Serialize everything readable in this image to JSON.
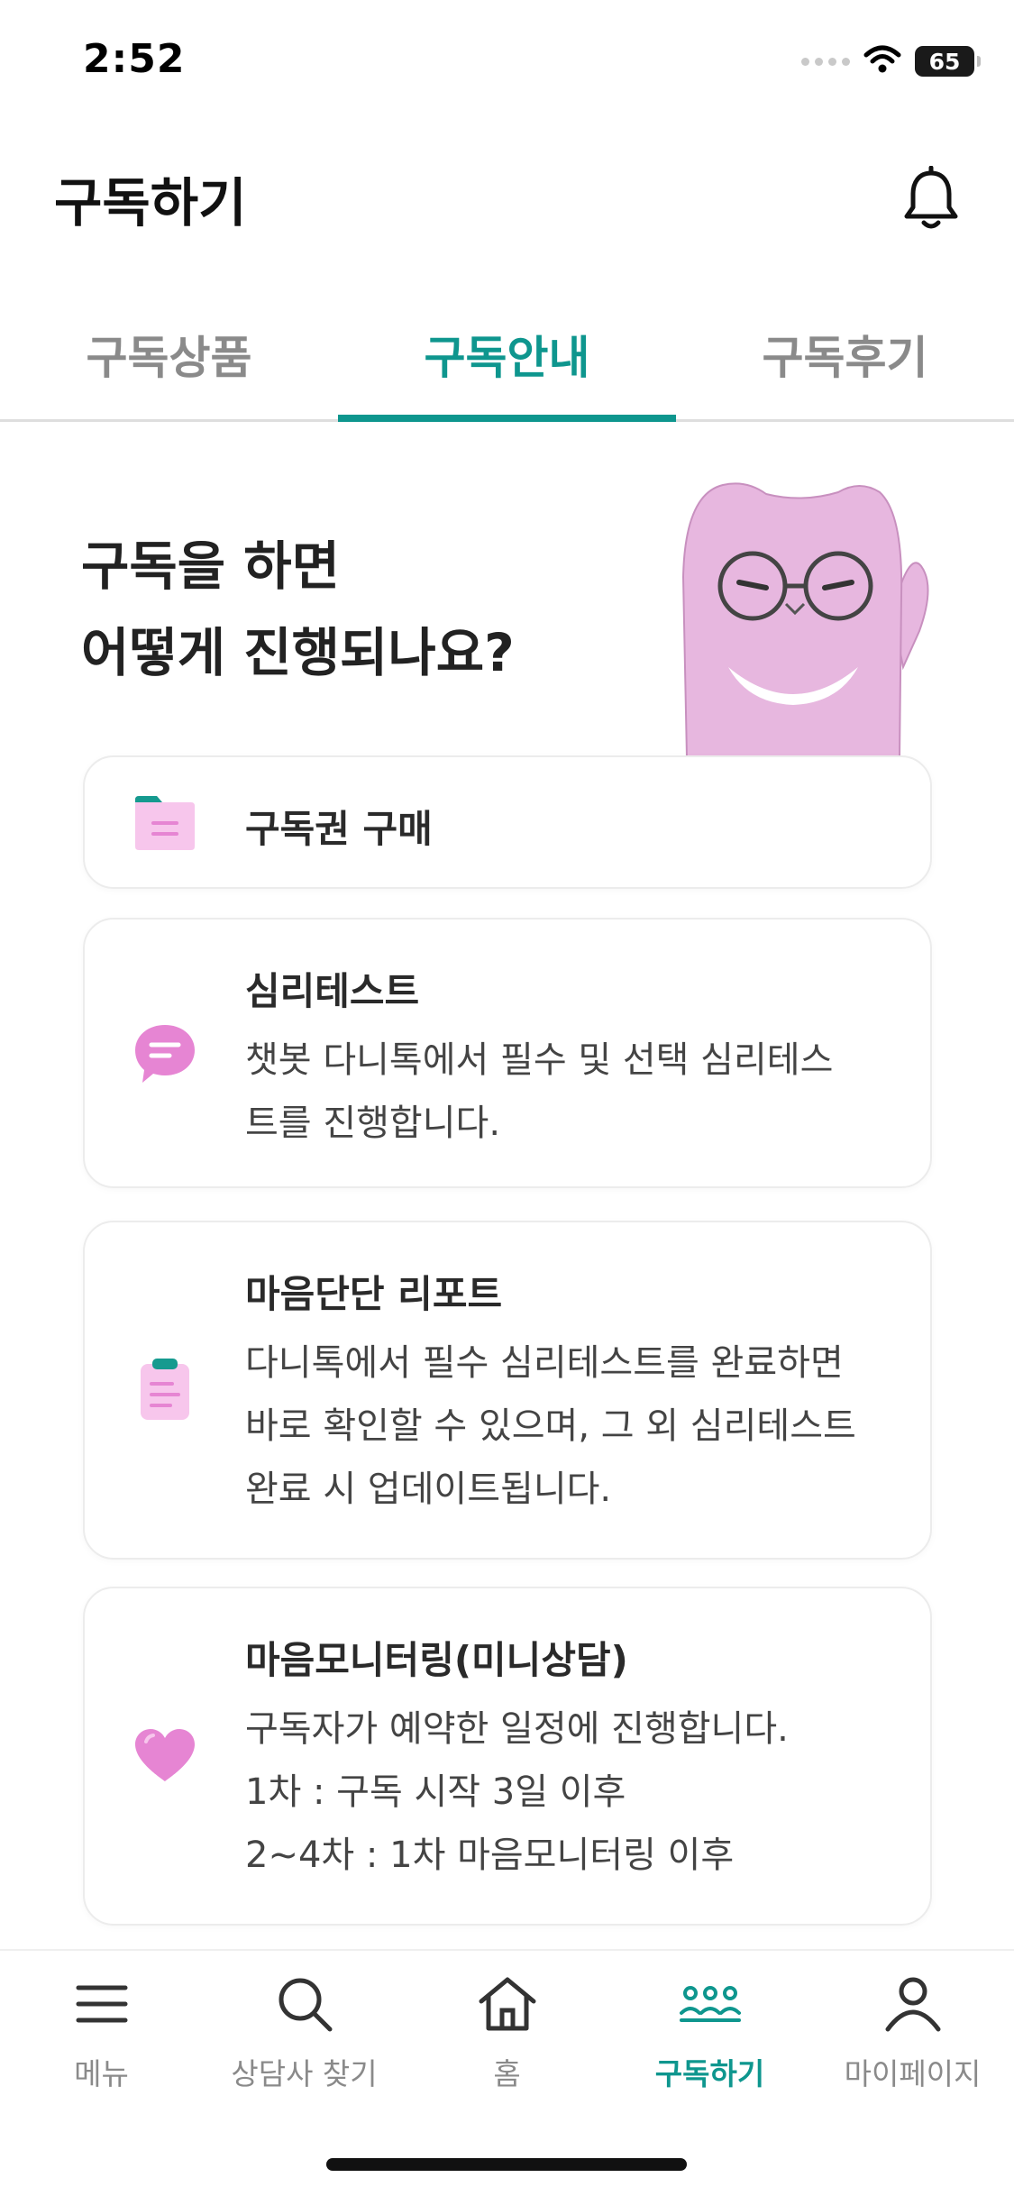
{
  "status_bar": {
    "time": "2:52",
    "battery": "65"
  },
  "header": {
    "title": "구독하기",
    "bell_icon": "bell-icon"
  },
  "tabs": [
    {
      "label": "구독상품",
      "active": false
    },
    {
      "label": "구독안내",
      "active": true
    },
    {
      "label": "구독후기",
      "active": false
    }
  ],
  "intro": {
    "line1": "구독을 하면",
    "line2": "어떻게 진행되나요?"
  },
  "steps": [
    {
      "title": "구독권 구매",
      "icon": "folder-icon",
      "desc": []
    },
    {
      "title": "심리테스트",
      "icon": "chat-bubble-icon",
      "desc": [
        "챗봇 다니톡에서 필수 및 선택 심리테스",
        "트를 진행합니다."
      ]
    },
    {
      "title": "마음단단 리포트",
      "icon": "clipboard-icon",
      "desc": [
        "다니톡에서 필수 심리테스트를 완료하면",
        "바로 확인할 수 있으며, 그 외 심리테스트",
        "완료 시 업데이트됩니다."
      ]
    },
    {
      "title": "마음모니터링(미니상담)",
      "icon": "heart-icon",
      "desc": [
        "구독자가 예약한 일정에 진행합니다.",
        "1차 : 구독 시작 3일 이후",
        "2~4차 : 1차 마음모니터링 이후"
      ]
    }
  ],
  "bottom_nav": [
    {
      "label": "메뉴",
      "icon": "menu-icon",
      "active": false
    },
    {
      "label": "상담사 찾기",
      "icon": "search-icon",
      "active": false
    },
    {
      "label": "홈",
      "icon": "home-icon",
      "active": false
    },
    {
      "label": "구독하기",
      "icon": "subscribe-icon",
      "active": true
    },
    {
      "label": "마이페이지",
      "icon": "person-icon",
      "active": false
    }
  ],
  "colors": {
    "accent": "#0e968e",
    "pink": "#e685d3",
    "pink_light": "#f7c6ec",
    "text": "#222222",
    "muted": "#8a8a8a"
  }
}
